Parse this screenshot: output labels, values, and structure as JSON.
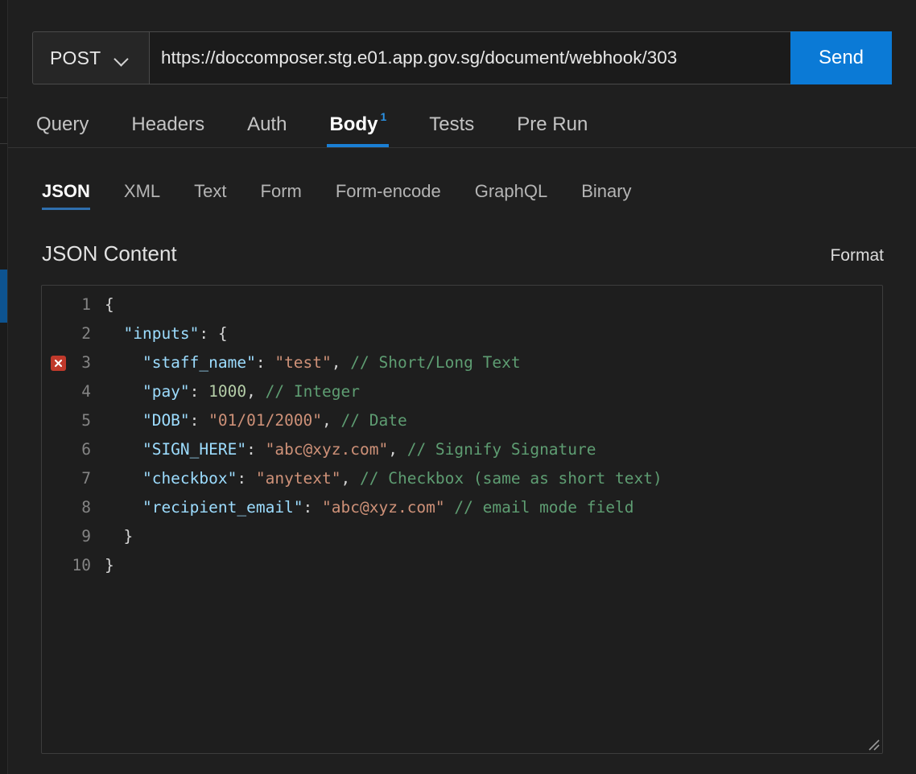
{
  "window": {
    "background": "#1f1f1f",
    "accent": "#0b7ad6"
  },
  "left_rail": {
    "active_indicator_color": "#0d5390"
  },
  "request_bar": {
    "method": "POST",
    "method_caret_icon": "chevron-down-icon",
    "url": "https://doccomposer.stg.e01.app.gov.sg/document/webhook/303",
    "url_placeholder": "Enter URL",
    "send_label": "Send"
  },
  "request_tabs": [
    {
      "label": "Query",
      "active": false,
      "badge": ""
    },
    {
      "label": "Headers",
      "active": false,
      "badge": ""
    },
    {
      "label": "Auth",
      "active": false,
      "badge": ""
    },
    {
      "label": "Body",
      "active": true,
      "badge": "1"
    },
    {
      "label": "Tests",
      "active": false,
      "badge": ""
    },
    {
      "label": "Pre Run",
      "active": false,
      "badge": ""
    }
  ],
  "body_format_tabs": [
    {
      "label": "JSON",
      "active": true
    },
    {
      "label": "XML",
      "active": false
    },
    {
      "label": "Text",
      "active": false
    },
    {
      "label": "Form",
      "active": false
    },
    {
      "label": "Form-encode",
      "active": false
    },
    {
      "label": "GraphQL",
      "active": false
    },
    {
      "label": "Binary",
      "active": false
    }
  ],
  "content_panel": {
    "title": "JSON Content",
    "format_label": "Format"
  },
  "editor": {
    "error_icon": "error-close-icon",
    "lines": [
      {
        "number": "1",
        "error": false,
        "tokens": [
          {
            "t": "punc",
            "v": "{"
          }
        ]
      },
      {
        "number": "2",
        "error": false,
        "tokens": [
          {
            "t": "key",
            "v": "  \"inputs\""
          },
          {
            "t": "punc",
            "v": ": {"
          }
        ]
      },
      {
        "number": "3",
        "error": true,
        "tokens": [
          {
            "t": "key",
            "v": "    \"staff_name\""
          },
          {
            "t": "punc",
            "v": ": "
          },
          {
            "t": "str",
            "v": "\"test\""
          },
          {
            "t": "punc",
            "v": ", "
          },
          {
            "t": "com",
            "v": "// Short/Long Text"
          }
        ]
      },
      {
        "number": "4",
        "error": false,
        "tokens": [
          {
            "t": "key",
            "v": "    \"pay\""
          },
          {
            "t": "punc",
            "v": ": "
          },
          {
            "t": "num",
            "v": "1000"
          },
          {
            "t": "punc",
            "v": ", "
          },
          {
            "t": "com",
            "v": "// Integer"
          }
        ]
      },
      {
        "number": "5",
        "error": false,
        "tokens": [
          {
            "t": "key",
            "v": "    \"DOB\""
          },
          {
            "t": "punc",
            "v": ": "
          },
          {
            "t": "str",
            "v": "\"01/01/2000\""
          },
          {
            "t": "punc",
            "v": ", "
          },
          {
            "t": "com",
            "v": "// Date"
          }
        ]
      },
      {
        "number": "6",
        "error": false,
        "tokens": [
          {
            "t": "key",
            "v": "    \"SIGN_HERE\""
          },
          {
            "t": "punc",
            "v": ": "
          },
          {
            "t": "str",
            "v": "\"abc@xyz.com\""
          },
          {
            "t": "punc",
            "v": ", "
          },
          {
            "t": "com",
            "v": "// Signify Signature"
          }
        ]
      },
      {
        "number": "7",
        "error": false,
        "tokens": [
          {
            "t": "key",
            "v": "    \"checkbox\""
          },
          {
            "t": "punc",
            "v": ": "
          },
          {
            "t": "str",
            "v": "\"anytext\""
          },
          {
            "t": "punc",
            "v": ", "
          },
          {
            "t": "com",
            "v": "// Checkbox (same as short text)"
          }
        ]
      },
      {
        "number": "8",
        "error": false,
        "tokens": [
          {
            "t": "key",
            "v": "    \"recipient_email\""
          },
          {
            "t": "punc",
            "v": ": "
          },
          {
            "t": "str",
            "v": "\"abc@xyz.com\""
          },
          {
            "t": "punc",
            "v": " "
          },
          {
            "t": "com",
            "v": "// email mode field"
          }
        ]
      },
      {
        "number": "9",
        "error": false,
        "tokens": [
          {
            "t": "punc",
            "v": "  }"
          }
        ]
      },
      {
        "number": "10",
        "error": false,
        "tokens": [
          {
            "t": "punc",
            "v": "}"
          }
        ]
      }
    ],
    "resize_handle_icon": "resize-grip-icon"
  }
}
